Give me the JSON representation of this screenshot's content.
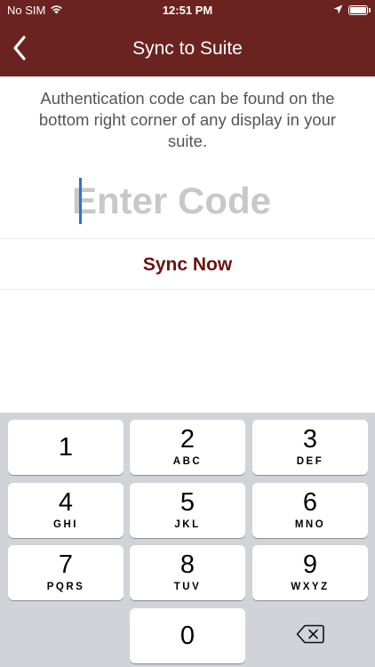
{
  "status_bar": {
    "carrier": "No SIM",
    "time": "12:51 PM"
  },
  "nav": {
    "title": "Sync to Suite",
    "back_icon": "chevron-left-icon"
  },
  "content": {
    "instructions": "Authentication code can be found on the bottom right corner of any display in your suite.",
    "code_value": "",
    "code_placeholder": "Enter Code",
    "sync_label": "Sync Now"
  },
  "keypad": {
    "keys": [
      {
        "digit": "1",
        "letters": ""
      },
      {
        "digit": "2",
        "letters": "ABC"
      },
      {
        "digit": "3",
        "letters": "DEF"
      },
      {
        "digit": "4",
        "letters": "GHI"
      },
      {
        "digit": "5",
        "letters": "JKL"
      },
      {
        "digit": "6",
        "letters": "MNO"
      },
      {
        "digit": "7",
        "letters": "PQRS"
      },
      {
        "digit": "8",
        "letters": "TUV"
      },
      {
        "digit": "9",
        "letters": "WXYZ"
      },
      {
        "digit": "0",
        "letters": ""
      }
    ],
    "delete_icon": "backspace-icon"
  },
  "colors": {
    "brand": "#6b2320",
    "sync_text": "#6b1410",
    "cursor": "#2f6fd8",
    "keypad_bg": "#d1d3d9"
  }
}
